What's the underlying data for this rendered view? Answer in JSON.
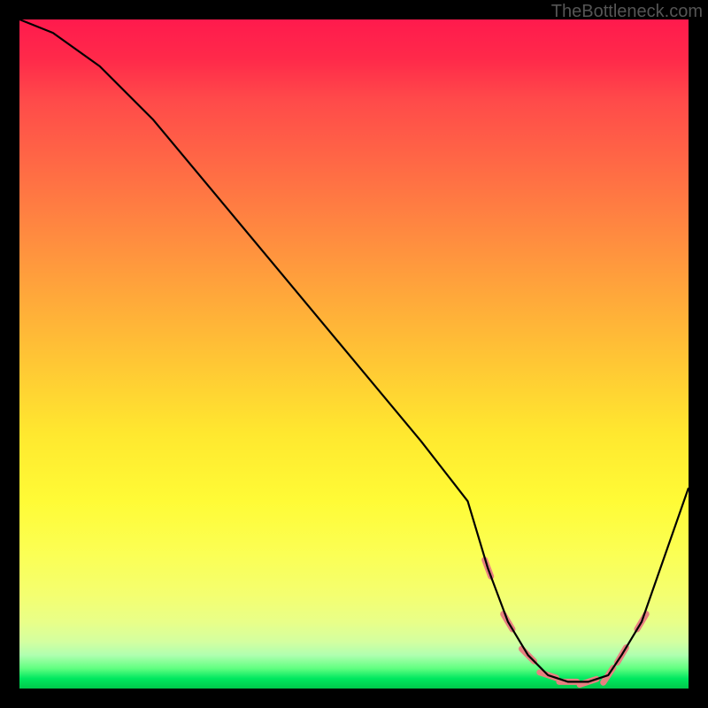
{
  "watermark": "TheBottleneck.com",
  "chart_data": {
    "type": "line",
    "title": "",
    "xlabel": "",
    "ylabel": "",
    "xlim": [
      0,
      100
    ],
    "ylim": [
      0,
      100
    ],
    "background_gradient": {
      "top_color": "#ff1a4d",
      "mid_color": "#ffe82f",
      "bottom_color": "#00c84a",
      "description": "vertical red→yellow→green gradient indicating bottleneck severity (red bad, green ideal)"
    },
    "series": [
      {
        "name": "bottleneck-curve",
        "color": "#000000",
        "x": [
          0,
          5,
          12,
          20,
          30,
          40,
          50,
          60,
          67,
          70,
          73,
          76,
          79,
          82,
          85,
          88,
          90,
          93,
          100
        ],
        "values": [
          100,
          98,
          93,
          85,
          73,
          61,
          49,
          37,
          28,
          18,
          10,
          5,
          2,
          1,
          1,
          2,
          5,
          10,
          30
        ]
      },
      {
        "name": "ideal-range-markers",
        "color": "#e88080",
        "style": "dashed-tick-marks",
        "x": [
          70,
          73,
          76,
          79,
          82,
          85,
          88,
          90,
          93
        ],
        "values": [
          18,
          10,
          5,
          2,
          1,
          1,
          2,
          5,
          10
        ]
      }
    ],
    "annotations": []
  }
}
